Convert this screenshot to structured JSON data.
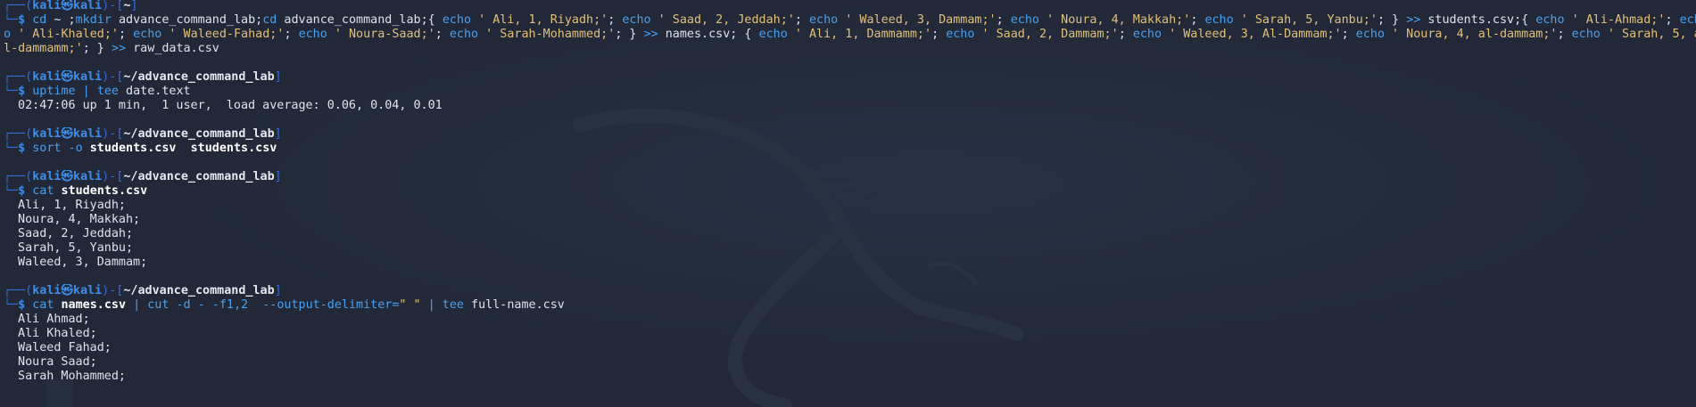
{
  "prompt": {
    "open": "┌──(",
    "user": "kali",
    "at": "㉿",
    "host": "kali",
    "sep": ")-[",
    "close": "]",
    "cont": "└─",
    "dollar": "$"
  },
  "blocks": [
    {
      "path": "~",
      "cmd_lines": [
        [
          {
            "t": "cd",
            "c": "cmd"
          },
          {
            "t": " ~ ;",
            "c": "arg"
          },
          {
            "t": "mkdir",
            "c": "cmd"
          },
          {
            "t": " advance_command_lab;",
            "c": "arg"
          },
          {
            "t": "cd",
            "c": "cmd"
          },
          {
            "t": " advance_command_lab;{ ",
            "c": "arg"
          },
          {
            "t": "echo",
            "c": "cmd"
          },
          {
            "t": " ' Ali, 1, Riyadh;'",
            "c": "str"
          },
          {
            "t": "; ",
            "c": "arg"
          },
          {
            "t": "echo",
            "c": "cmd"
          },
          {
            "t": " ' Saad, 2, Jeddah;'",
            "c": "str"
          },
          {
            "t": "; ",
            "c": "arg"
          },
          {
            "t": "echo",
            "c": "cmd"
          },
          {
            "t": " ' Waleed, 3, Dammam;'",
            "c": "str"
          },
          {
            "t": "; ",
            "c": "arg"
          },
          {
            "t": "echo",
            "c": "cmd"
          },
          {
            "t": " ' Noura, 4, Makkah;'",
            "c": "str"
          },
          {
            "t": "; ",
            "c": "arg"
          },
          {
            "t": "echo",
            "c": "cmd"
          },
          {
            "t": " ' Sarah, 5, Yanbu;'",
            "c": "str"
          },
          {
            "t": "; } ",
            "c": "arg"
          },
          {
            "t": ">>",
            "c": "op"
          },
          {
            "t": " students.csv;{ ",
            "c": "arg"
          },
          {
            "t": "echo",
            "c": "cmd"
          },
          {
            "t": " ' Ali-Ahmad;'",
            "c": "str"
          },
          {
            "t": "; ",
            "c": "arg"
          },
          {
            "t": "ech",
            "c": "cmd"
          }
        ],
        [
          {
            "t": "o",
            "c": "cmd"
          },
          {
            "t": " ' Ali-Khaled;'",
            "c": "str"
          },
          {
            "t": "; ",
            "c": "arg"
          },
          {
            "t": "echo",
            "c": "cmd"
          },
          {
            "t": " ' Waleed-Fahad;'",
            "c": "str"
          },
          {
            "t": "; ",
            "c": "arg"
          },
          {
            "t": "echo",
            "c": "cmd"
          },
          {
            "t": " ' Noura-Saad;'",
            "c": "str"
          },
          {
            "t": "; ",
            "c": "arg"
          },
          {
            "t": "echo",
            "c": "cmd"
          },
          {
            "t": " ' Sarah-Mohammed;'",
            "c": "str"
          },
          {
            "t": "; } ",
            "c": "arg"
          },
          {
            "t": ">>",
            "c": "op"
          },
          {
            "t": " names.csv; { ",
            "c": "arg"
          },
          {
            "t": "echo",
            "c": "cmd"
          },
          {
            "t": " ' Ali, 1, Dammamm;'",
            "c": "str"
          },
          {
            "t": "; ",
            "c": "arg"
          },
          {
            "t": "echo",
            "c": "cmd"
          },
          {
            "t": " ' Saad, 2, Dammam;'",
            "c": "str"
          },
          {
            "t": "; ",
            "c": "arg"
          },
          {
            "t": "echo",
            "c": "cmd"
          },
          {
            "t": " ' Waleed, 3, Al-Dammam;'",
            "c": "str"
          },
          {
            "t": "; ",
            "c": "arg"
          },
          {
            "t": "echo",
            "c": "cmd"
          },
          {
            "t": " ' Noura, 4, al-dammam;'",
            "c": "str"
          },
          {
            "t": "; ",
            "c": "arg"
          },
          {
            "t": "echo",
            "c": "cmd"
          },
          {
            "t": " ' Sarah, 5, a",
            "c": "str"
          }
        ],
        [
          {
            "t": "l-dammamm;'",
            "c": "str"
          },
          {
            "t": "; } ",
            "c": "arg"
          },
          {
            "t": ">>",
            "c": "op"
          },
          {
            "t": " raw_data.csv",
            "c": "arg"
          }
        ]
      ],
      "output": []
    },
    {
      "path": "~/advance_command_lab",
      "cmd_lines": [
        [
          {
            "t": "uptime",
            "c": "cmd"
          },
          {
            "t": " | ",
            "c": "op"
          },
          {
            "t": "tee",
            "c": "cmd"
          },
          {
            "t": " date.text",
            "c": "arg"
          }
        ]
      ],
      "output": [
        " 02:47:06 up 1 min,  1 user,  load average: 0.06, 0.04, 0.01"
      ]
    },
    {
      "path": "~/advance_command_lab",
      "cmd_lines": [
        [
          {
            "t": "sort",
            "c": "cmd"
          },
          {
            "t": " -o ",
            "c": "cmd"
          },
          {
            "t": "students.csv",
            "c": "bold"
          },
          {
            "t": "  ",
            "c": "arg"
          },
          {
            "t": "students.csv",
            "c": "bold"
          }
        ]
      ],
      "output": []
    },
    {
      "path": "~/advance_command_lab",
      "cmd_lines": [
        [
          {
            "t": "cat",
            "c": "cmd"
          },
          {
            "t": " ",
            "c": "arg"
          },
          {
            "t": "students.csv",
            "c": "bold"
          }
        ]
      ],
      "output": [
        " Ali, 1, Riyadh;",
        " Noura, 4, Makkah;",
        " Saad, 2, Jeddah;",
        " Sarah, 5, Yanbu;",
        " Waleed, 3, Dammam;"
      ]
    },
    {
      "path": "~/advance_command_lab",
      "cmd_lines": [
        [
          {
            "t": "cat",
            "c": "cmd"
          },
          {
            "t": " ",
            "c": "arg"
          },
          {
            "t": "names.csv",
            "c": "bold"
          },
          {
            "t": " | ",
            "c": "op"
          },
          {
            "t": "cut",
            "c": "cmd"
          },
          {
            "t": " -d - -f1,2  --output-delimiter=",
            "c": "cmd"
          },
          {
            "t": "\" \"",
            "c": "str"
          },
          {
            "t": " | ",
            "c": "op"
          },
          {
            "t": "tee",
            "c": "cmd"
          },
          {
            "t": " full-name.csv",
            "c": "arg"
          }
        ]
      ],
      "output": [
        " Ali Ahmad;",
        " Ali Khaled;",
        " Waleed Fahad;",
        " Noura Saad;",
        " Sarah Mohammed;"
      ]
    }
  ]
}
